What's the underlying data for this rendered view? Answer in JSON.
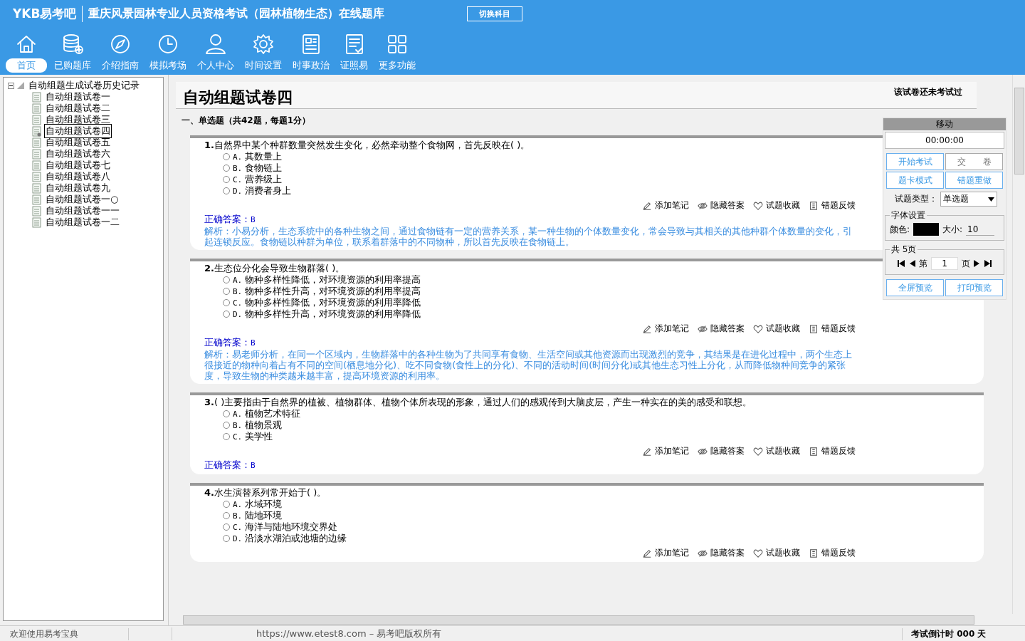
{
  "header": {
    "logo": "YKB易考吧",
    "title": "重庆风景园林专业人员资格考试（园林植物生态）在线题库",
    "switch_button": "切换科目"
  },
  "nav": [
    {
      "label": "首页",
      "selected": true
    },
    {
      "label": "已购题库",
      "selected": false
    },
    {
      "label": "介绍指南",
      "selected": false
    },
    {
      "label": "模拟考场",
      "selected": false
    },
    {
      "label": "个人中心",
      "selected": false
    },
    {
      "label": "时间设置",
      "selected": false
    },
    {
      "label": "时事政治",
      "selected": false
    },
    {
      "label": "证照易",
      "selected": false
    },
    {
      "label": "更多功能",
      "selected": false
    }
  ],
  "tree": {
    "root": "自动组题生成试卷历史记录",
    "expanded": true,
    "children": [
      {
        "label": "自动组题试卷一",
        "selected": false
      },
      {
        "label": "自动组题试卷二",
        "selected": false
      },
      {
        "label": "自动组题试卷三",
        "selected": false
      },
      {
        "label": "自动组题试卷四",
        "selected": true
      },
      {
        "label": "自动组题试卷五",
        "selected": false
      },
      {
        "label": "自动组题试卷六",
        "selected": false
      },
      {
        "label": "自动组题试卷七",
        "selected": false
      },
      {
        "label": "自动组题试卷八",
        "selected": false
      },
      {
        "label": "自动组题试卷九",
        "selected": false
      },
      {
        "label": "自动组题试卷一○",
        "selected": false
      },
      {
        "label": "自动组题试卷一一",
        "selected": false
      },
      {
        "label": "自动组题试卷一二",
        "selected": false
      }
    ]
  },
  "paper": {
    "title": "自动组题试卷四",
    "status": "该试卷还未考试过",
    "section": "一、单选题（共42题，每题1分）"
  },
  "questions": [
    {
      "number": "1.",
      "text": "自然界中某个种群数量突然发生变化，必然牵动整个食物网，首先反映在( )。",
      "options": [
        {
          "label": "A.",
          "text": "其数量上",
          "selected": false
        },
        {
          "label": "B.",
          "text": "食物链上",
          "selected": false
        },
        {
          "label": "C.",
          "text": "营养级上",
          "selected": false
        },
        {
          "label": "D.",
          "text": "消费者身上",
          "selected": false
        }
      ],
      "actions": [
        "添加笔记",
        "隐藏答案",
        "试题收藏",
        "错题反馈"
      ],
      "answer_label": "正确答案：",
      "answer": "B",
      "explanation": "解析：小易分析，生态系统中的各种生物之间，通过食物链有一定的营养关系，某一种生物的个体数量变化，常会导致与其相关的其他种群个体数量的变化，引起连锁反应。食物链以种群为单位，联系着群落中的不同物种，所以首先反映在食物链上。"
    },
    {
      "number": "2.",
      "text": "生态位分化会导致生物群落( )。",
      "options": [
        {
          "label": "A.",
          "text": "物种多样性降低，对环境资源的利用率提高",
          "selected": false
        },
        {
          "label": "B.",
          "text": "物种多样性升高，对环境资源的利用率提高",
          "selected": false
        },
        {
          "label": "C.",
          "text": "物种多样性降低，对环境资源的利用率降低",
          "selected": false
        },
        {
          "label": "D.",
          "text": "物种多样性升高，对环境资源的利用率降低",
          "selected": false
        }
      ],
      "actions": [
        "添加笔记",
        "隐藏答案",
        "试题收藏",
        "错题反馈"
      ],
      "answer_label": "正确答案：",
      "answer": "B",
      "explanation": "解析：易老师分析，在同一个区域内，生物群落中的各种生物为了共同享有食物、生活空间或其他资源而出现激烈的竞争，其结果是在进化过程中，两个生态上很接近的物种向着占有不同的空间(栖息地分化)、吃不同食物(食性上的分化)、不同的活动时间(时间分化)或其他生态习性上分化，从而降低物种间竞争的紧张度，导致生物的种类越来越丰富，提高环境资源的利用率。"
    },
    {
      "number": "3.",
      "text": "( )主要指由于自然界的植被、植物群体、植物个体所表现的形象，通过人们的感观传到大脑皮层，产生一种实在的美的感受和联想。",
      "options": [
        {
          "label": "A.",
          "text": "植物艺术特征",
          "selected": false
        },
        {
          "label": "B.",
          "text": "植物景观",
          "selected": false
        },
        {
          "label": "C.",
          "text": "美学性",
          "selected": false
        }
      ],
      "actions": [
        "添加笔记",
        "隐藏答案",
        "试题收藏",
        "错题反馈"
      ],
      "answer_label": "正确答案：",
      "answer": "B"
    },
    {
      "number": "4.",
      "text": "水生演替系列常开始于( )。",
      "options": [
        {
          "label": "A.",
          "text": "水域环境",
          "selected": false
        },
        {
          "label": "B.",
          "text": "陆地环境",
          "selected": false
        },
        {
          "label": "C.",
          "text": "海洋与陆地环境交界处",
          "selected": false
        },
        {
          "label": "D.",
          "text": "沿淡水湖泊或池塘的边缘",
          "selected": false
        }
      ],
      "actions": [
        "添加笔记",
        "隐藏答案",
        "试题收藏",
        "错题反馈"
      ]
    }
  ],
  "panel": {
    "handle": "移动",
    "timer": "00:00:00",
    "buttons": [
      "开始考试",
      "交　　卷",
      "题卡模式",
      "错题重做"
    ],
    "type_label": "试题类型：",
    "type_value": "单选题",
    "font_legend": "字体设置",
    "color_label": "颜色:",
    "color": "#000000",
    "size_label": "大小:",
    "size_value": "10",
    "pages_legend": "共 5页",
    "page_prefix": "第",
    "page_value": "1",
    "page_suffix": "页",
    "preview_buttons": [
      "全屏预览",
      "打印预览"
    ]
  },
  "status_bar": {
    "welcome": "欢迎使用易考宝典",
    "copyright": "https://www.etest8.com – 易考吧版权所有",
    "countdown": "考试倒计时 000 天"
  }
}
